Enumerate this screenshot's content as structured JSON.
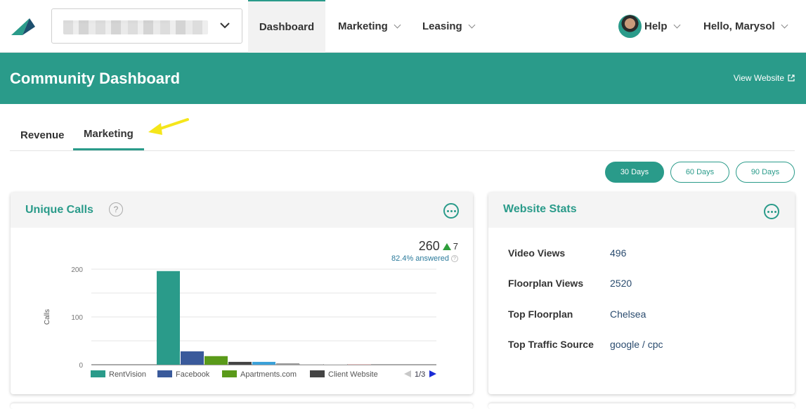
{
  "nav": {
    "property_selector_value": "",
    "items": [
      {
        "label": "Dashboard"
      },
      {
        "label": "Marketing"
      },
      {
        "label": "Leasing"
      }
    ],
    "help": "Help",
    "greeting": "Hello, Marysol"
  },
  "header": {
    "title": "Community Dashboard",
    "view_website": "View Website"
  },
  "tabs": [
    {
      "label": "Revenue"
    },
    {
      "label": "Marketing"
    }
  ],
  "ranges": [
    {
      "label": "30 Days",
      "active": true
    },
    {
      "label": "60 Days",
      "active": false
    },
    {
      "label": "90 Days",
      "active": false
    }
  ],
  "unique_calls": {
    "title": "Unique Calls",
    "help": "?",
    "total": "260",
    "delta": "7",
    "answered": "82.4% answered",
    "legend_page": "1/3"
  },
  "website_stats": {
    "title": "Website Stats",
    "rows": [
      {
        "label": "Video Views",
        "value": "496"
      },
      {
        "label": "Floorplan Views",
        "value": "2520"
      },
      {
        "label": "Top Floorplan",
        "value": "Chelsea"
      },
      {
        "label": "Top Traffic Source",
        "value": "google / cpc"
      }
    ]
  },
  "colors": {
    "accent": "#2a9b8a"
  },
  "chart_data": {
    "type": "bar",
    "ylabel": "Calls",
    "ylim": [
      0,
      200
    ],
    "yticks": [
      0,
      100,
      200
    ],
    "grid": true,
    "legend_position": "bottom",
    "series": [
      {
        "name": "RentVision",
        "value": 196,
        "color": "#2a9b8a"
      },
      {
        "name": "Facebook",
        "value": 28,
        "color": "#3a5a9b"
      },
      {
        "name": "Apartments.com",
        "value": 18,
        "color": "#5a9a1a"
      },
      {
        "name": "",
        "value": 6,
        "color": "#444444"
      },
      {
        "name": "",
        "value": 6,
        "color": "#3aa0d8"
      },
      {
        "name": "",
        "value": 3,
        "color": "#999999"
      },
      {
        "name": "",
        "value": 1,
        "color": "#bbbbbb"
      },
      {
        "name": "",
        "value": 1,
        "color": "#cfcfcf"
      },
      {
        "name": "",
        "value": 1,
        "color": "#d8a0a0"
      }
    ],
    "legend": [
      {
        "name": "RentVision",
        "color": "#2a9b8a"
      },
      {
        "name": "Facebook",
        "color": "#3a5a9b"
      },
      {
        "name": "Apartments.com",
        "color": "#5a9a1a"
      },
      {
        "name": "Client Website",
        "color": "#444444"
      }
    ]
  }
}
